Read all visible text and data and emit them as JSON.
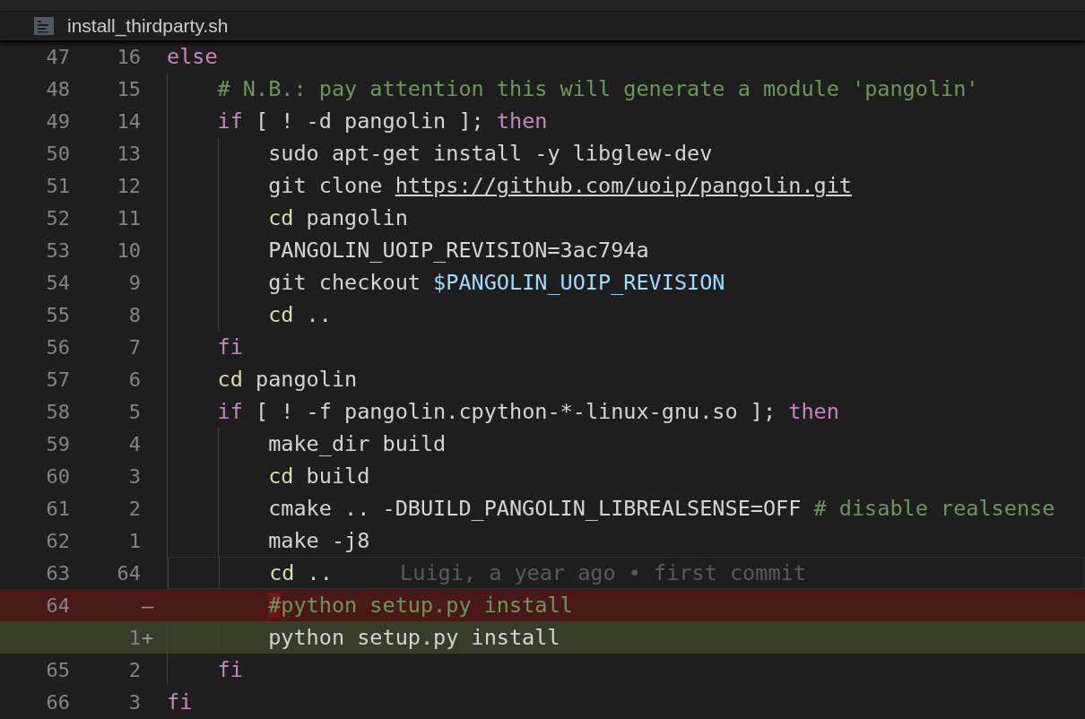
{
  "tab": {
    "title": "install_thirdparty.sh"
  },
  "lines": [
    {
      "kind": "normal",
      "orig": "47",
      "rel": "16",
      "tokens": [
        {
          "kind": "kw",
          "t": "else"
        }
      ],
      "children": [
        {
          "kind": "normal",
          "orig": "48",
          "rel": "15",
          "tokens": [
            {
              "kind": "comment",
              "t": "# N.B.: pay attention this will generate a module 'pangolin'"
            }
          ]
        },
        {
          "kind": "normal",
          "orig": "49",
          "rel": "14",
          "tokens": [
            {
              "kind": "kw",
              "t": "if"
            },
            {
              "kind": "plain",
              "t": " [ ! -d pangolin ]; "
            },
            {
              "kind": "kw",
              "t": "then"
            }
          ],
          "children": [
            {
              "kind": "normal",
              "orig": "50",
              "rel": "13",
              "tokens": [
                {
                  "kind": "plain",
                  "t": "sudo apt-get install -y libglew-dev"
                }
              ]
            },
            {
              "kind": "normal",
              "orig": "51",
              "rel": "12",
              "tokens": [
                {
                  "kind": "plain",
                  "t": "git clone "
                },
                {
                  "kind": "link",
                  "t": "https://github.com/uoip/pangolin.git"
                }
              ]
            },
            {
              "kind": "normal",
              "orig": "52",
              "rel": "11",
              "tokens": [
                {
                  "kind": "fn",
                  "t": "cd"
                },
                {
                  "kind": "plain",
                  "t": " pangolin"
                }
              ]
            },
            {
              "kind": "normal",
              "orig": "53",
              "rel": "10",
              "tokens": [
                {
                  "kind": "plain",
                  "t": "PANGOLIN_UOIP_REVISION=3ac794a"
                }
              ]
            },
            {
              "kind": "normal",
              "orig": "54",
              "rel": "9",
              "tokens": [
                {
                  "kind": "plain",
                  "t": "git checkout "
                },
                {
                  "kind": "var",
                  "t": "$PANGOLIN_UOIP_REVISION"
                }
              ]
            },
            {
              "kind": "normal",
              "orig": "55",
              "rel": "8",
              "tokens": [
                {
                  "kind": "fn",
                  "t": "cd"
                },
                {
                  "kind": "plain",
                  "t": " .."
                }
              ]
            }
          ]
        },
        {
          "kind": "normal",
          "orig": "56",
          "rel": "7",
          "tokens": [
            {
              "kind": "kw",
              "t": "fi"
            }
          ]
        },
        {
          "kind": "normal",
          "orig": "57",
          "rel": "6",
          "tokens": [
            {
              "kind": "fn",
              "t": "cd"
            },
            {
              "kind": "plain",
              "t": " pangolin"
            }
          ]
        },
        {
          "kind": "normal",
          "orig": "58",
          "rel": "5",
          "tokens": [
            {
              "kind": "kw",
              "t": "if"
            },
            {
              "kind": "plain",
              "t": " [ ! -f pangolin.cpython-*-linux-gnu.so ]; "
            },
            {
              "kind": "kw",
              "t": "then"
            }
          ],
          "children": [
            {
              "kind": "normal",
              "orig": "59",
              "rel": "4",
              "tokens": [
                {
                  "kind": "plain",
                  "t": "make_dir build"
                }
              ]
            },
            {
              "kind": "normal",
              "orig": "60",
              "rel": "3",
              "tokens": [
                {
                  "kind": "fn",
                  "t": "cd"
                },
                {
                  "kind": "plain",
                  "t": " build"
                }
              ]
            },
            {
              "kind": "normal",
              "orig": "61",
              "rel": "2",
              "tokens": [
                {
                  "kind": "plain",
                  "t": "cmake .. -DBUILD_PANGOLIN_LIBREALSENSE=OFF "
                },
                {
                  "kind": "comment",
                  "t": "# disable realsense"
                }
              ]
            },
            {
              "kind": "normal",
              "orig": "62",
              "rel": "1",
              "tokens": [
                {
                  "kind": "plain",
                  "t": "make -j8"
                }
              ]
            },
            {
              "kind": "current",
              "orig": "63",
              "rel": "64",
              "tokens": [
                {
                  "kind": "fn",
                  "t": "cd"
                },
                {
                  "kind": "plain",
                  "t": " .."
                }
              ],
              "blame": "Luigi, a year ago • first commit"
            },
            {
              "kind": "removed",
              "orig": "64",
              "marker": "—",
              "tokens": [
                {
                  "kind": "comment",
                  "t": "#",
                  "changed": true
                },
                {
                  "kind": "comment",
                  "t": "python setup.py install"
                }
              ]
            },
            {
              "kind": "added",
              "rel": "1",
              "marker": "+",
              "tokens": [
                {
                  "kind": "plain",
                  "t": "python setup.py install"
                }
              ]
            }
          ]
        },
        {
          "kind": "normal",
          "orig": "65",
          "rel": "2",
          "tokens": [
            {
              "kind": "kw",
              "t": "fi"
            }
          ]
        }
      ]
    },
    {
      "kind": "normal",
      "orig": "66",
      "rel": "3",
      "tokens": [
        {
          "kind": "kw",
          "t": "fi"
        }
      ]
    }
  ]
}
